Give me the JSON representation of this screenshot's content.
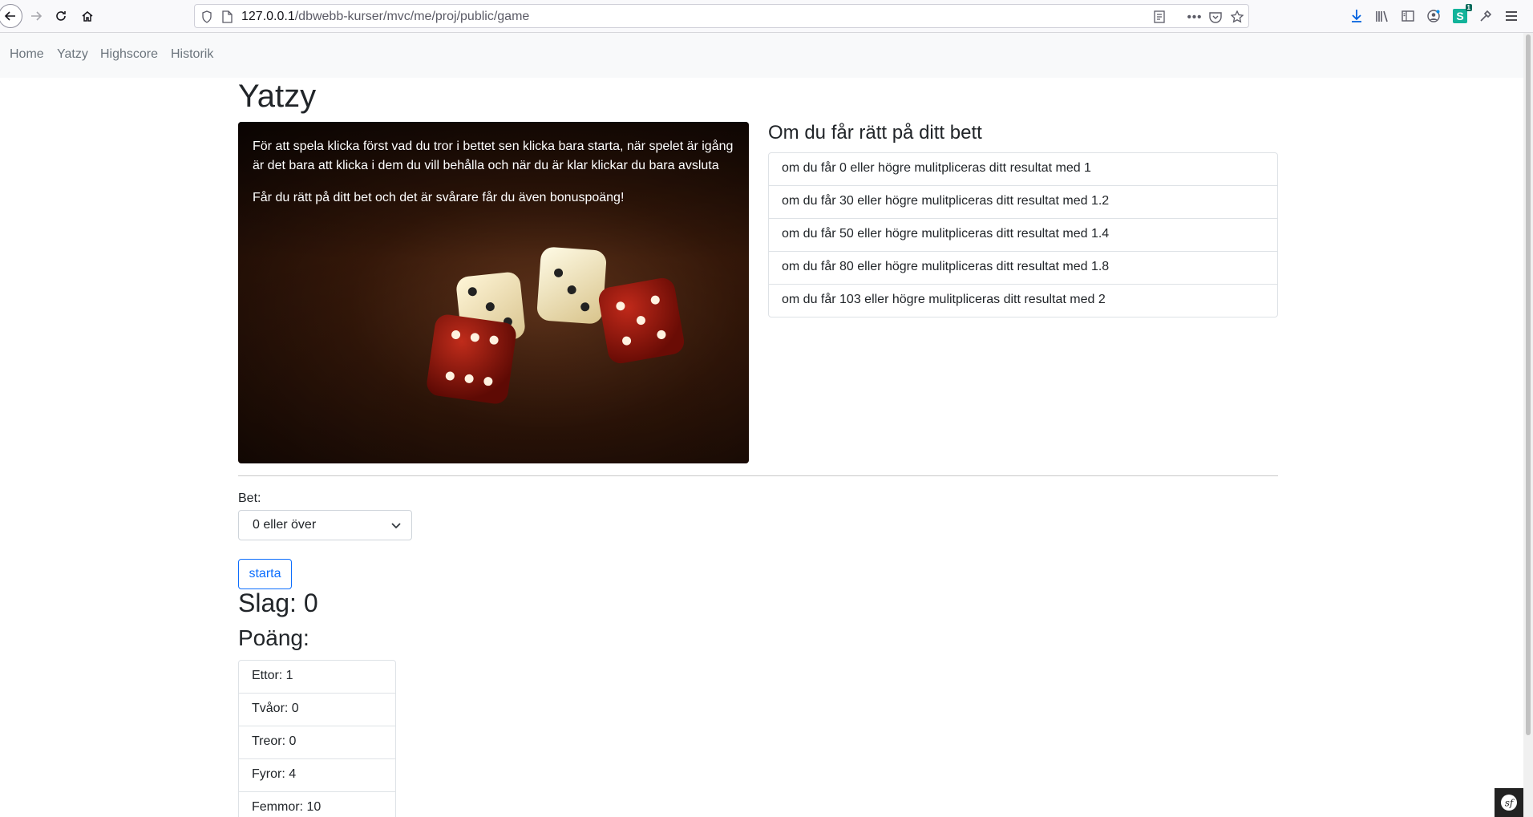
{
  "browser": {
    "url_host": "127.0.0.1",
    "url_path": "/dbwebb-kurser/mvc/me/proj/public/game",
    "extension_badge": "1"
  },
  "nav": {
    "items": [
      "Home",
      "Yatzy",
      "Highscore",
      "Historik"
    ]
  },
  "page": {
    "title": "Yatzy",
    "hero": {
      "instructions": "För att spela klicka först vad du tror i bettet sen klicka bara starta, när spelet är igång är det bara att klicka i dem du vill behålla och när du är klar klickar du bara avsluta",
      "bonus_note": "Får du rätt på ditt bet och det är svårare får du även bonuspoäng!"
    },
    "bet_info": {
      "title": "Om du får rätt på ditt bett",
      "items": [
        "om du får 0 eller högre mulitpliceras ditt resultat med 1",
        "om du får 30 eller högre mulitpliceras ditt resultat med 1.2",
        "om du får 50 eller högre mulitpliceras ditt resultat med 1.4",
        "om du får 80 eller högre mulitpliceras ditt resultat med 1.8",
        "om du får 103 eller högre mulitpliceras ditt resultat med 2"
      ]
    },
    "bet_form": {
      "label": "Bet:",
      "selected": "0 eller över",
      "start_label": "starta"
    },
    "throws": "Slag: 0",
    "points_title": "Poäng:",
    "scores": [
      "Ettor: 1",
      "Tvåor: 0",
      "Treor: 0",
      "Fyror: 4",
      "Femmor: 10"
    ]
  },
  "colors": {
    "primary": "#0d6efd",
    "navbar_bg": "#f8f9fa",
    "nav_link": "#6c757d"
  }
}
